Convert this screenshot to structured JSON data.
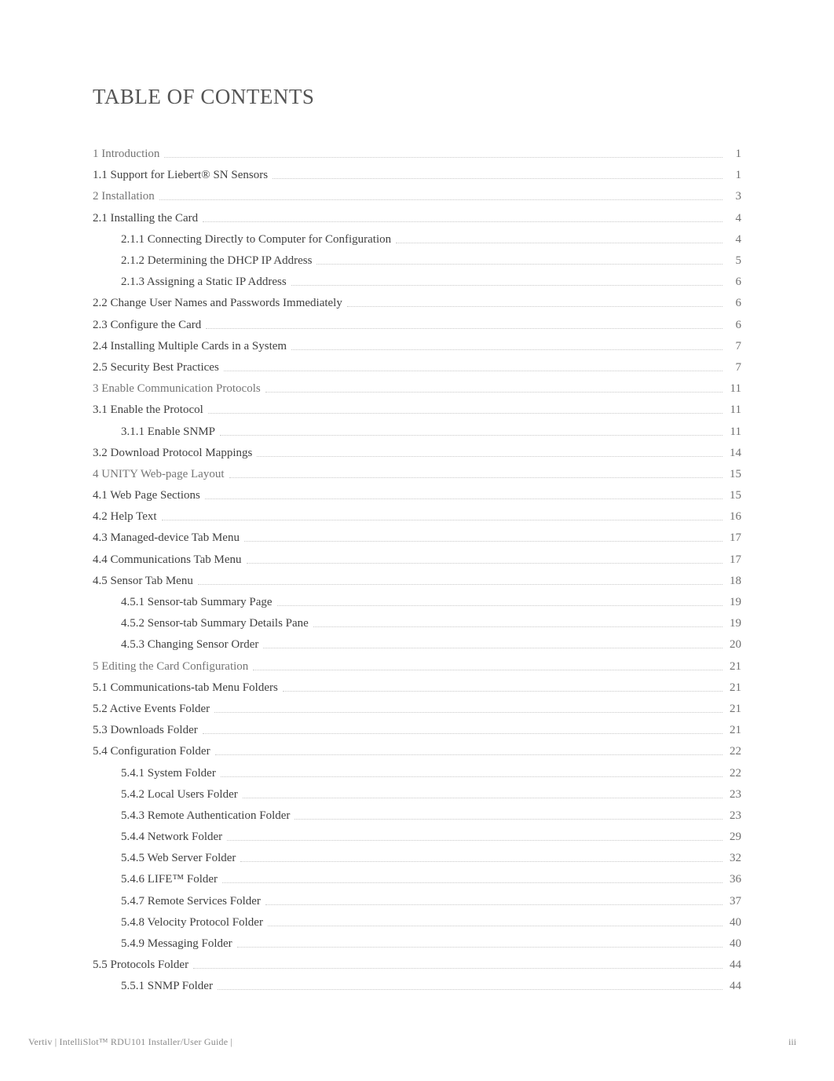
{
  "title": "TABLE OF CONTENTS",
  "entries": [
    {
      "label": "1 Introduction",
      "page": "1",
      "indent": 0,
      "chapter": true
    },
    {
      "label": "1.1 Support for Liebert® SN Sensors",
      "page": "1",
      "indent": 0,
      "chapter": false
    },
    {
      "label": "2 Installation",
      "page": "3",
      "indent": 0,
      "chapter": true
    },
    {
      "label": "2.1 Installing the Card",
      "page": "4",
      "indent": 0,
      "chapter": false
    },
    {
      "label": "2.1.1 Connecting Directly to Computer for Configuration",
      "page": "4",
      "indent": 1,
      "chapter": false
    },
    {
      "label": "2.1.2 Determining the DHCP IP Address",
      "page": "5",
      "indent": 1,
      "chapter": false
    },
    {
      "label": "2.1.3 Assigning a Static IP Address",
      "page": "6",
      "indent": 1,
      "chapter": false
    },
    {
      "label": "2.2 Change User Names and Passwords Immediately",
      "page": "6",
      "indent": 0,
      "chapter": false
    },
    {
      "label": "2.3 Configure the Card",
      "page": "6",
      "indent": 0,
      "chapter": false
    },
    {
      "label": "2.4 Installing Multiple Cards in a System",
      "page": "7",
      "indent": 0,
      "chapter": false
    },
    {
      "label": "2.5 Security Best Practices",
      "page": "7",
      "indent": 0,
      "chapter": false
    },
    {
      "label": "3 Enable Communication Protocols",
      "page": "11",
      "indent": 0,
      "chapter": true
    },
    {
      "label": "3.1 Enable the Protocol",
      "page": "11",
      "indent": 0,
      "chapter": false
    },
    {
      "label": "3.1.1 Enable SNMP",
      "page": "11",
      "indent": 1,
      "chapter": false
    },
    {
      "label": "3.2 Download Protocol Mappings",
      "page": "14",
      "indent": 0,
      "chapter": false
    },
    {
      "label": "4 UNITY Web-page Layout",
      "page": "15",
      "indent": 0,
      "chapter": true
    },
    {
      "label": "4.1 Web Page Sections",
      "page": "15",
      "indent": 0,
      "chapter": false
    },
    {
      "label": "4.2 Help Text",
      "page": "16",
      "indent": 0,
      "chapter": false
    },
    {
      "label": "4.3 Managed-device Tab Menu",
      "page": "17",
      "indent": 0,
      "chapter": false
    },
    {
      "label": "4.4 Communications Tab Menu",
      "page": "17",
      "indent": 0,
      "chapter": false
    },
    {
      "label": "4.5 Sensor Tab Menu",
      "page": "18",
      "indent": 0,
      "chapter": false
    },
    {
      "label": "4.5.1 Sensor-tab Summary Page",
      "page": "19",
      "indent": 1,
      "chapter": false
    },
    {
      "label": "4.5.2 Sensor-tab Summary Details Pane",
      "page": "19",
      "indent": 1,
      "chapter": false
    },
    {
      "label": "4.5.3 Changing Sensor Order",
      "page": "20",
      "indent": 1,
      "chapter": false
    },
    {
      "label": "5 Editing the Card Configuration",
      "page": "21",
      "indent": 0,
      "chapter": true
    },
    {
      "label": "5.1 Communications-tab Menu Folders",
      "page": "21",
      "indent": 0,
      "chapter": false
    },
    {
      "label": "5.2 Active Events Folder",
      "page": "21",
      "indent": 0,
      "chapter": false
    },
    {
      "label": "5.3 Downloads Folder",
      "page": "21",
      "indent": 0,
      "chapter": false
    },
    {
      "label": "5.4 Configuration Folder",
      "page": "22",
      "indent": 0,
      "chapter": false
    },
    {
      "label": "5.4.1 System Folder",
      "page": "22",
      "indent": 1,
      "chapter": false
    },
    {
      "label": "5.4.2 Local Users Folder",
      "page": "23",
      "indent": 1,
      "chapter": false
    },
    {
      "label": "5.4.3 Remote Authentication Folder",
      "page": "23",
      "indent": 1,
      "chapter": false
    },
    {
      "label": "5.4.4 Network Folder",
      "page": "29",
      "indent": 1,
      "chapter": false
    },
    {
      "label": "5.4.5 Web Server Folder",
      "page": "32",
      "indent": 1,
      "chapter": false
    },
    {
      "label": "5.4.6 LIFE™ Folder",
      "page": "36",
      "indent": 1,
      "chapter": false
    },
    {
      "label": "5.4.7 Remote Services Folder",
      "page": "37",
      "indent": 1,
      "chapter": false
    },
    {
      "label": "5.4.8 Velocity Protocol Folder",
      "page": "40",
      "indent": 1,
      "chapter": false
    },
    {
      "label": "5.4.9 Messaging Folder",
      "page": "40",
      "indent": 1,
      "chapter": false
    },
    {
      "label": "5.5 Protocols Folder",
      "page": "44",
      "indent": 0,
      "chapter": false
    },
    {
      "label": "5.5.1 SNMP Folder",
      "page": "44",
      "indent": 1,
      "chapter": false
    }
  ],
  "footer": {
    "left": "Vertiv | IntelliSlot™ RDU101 Installer/User Guide |",
    "right": "iii"
  }
}
